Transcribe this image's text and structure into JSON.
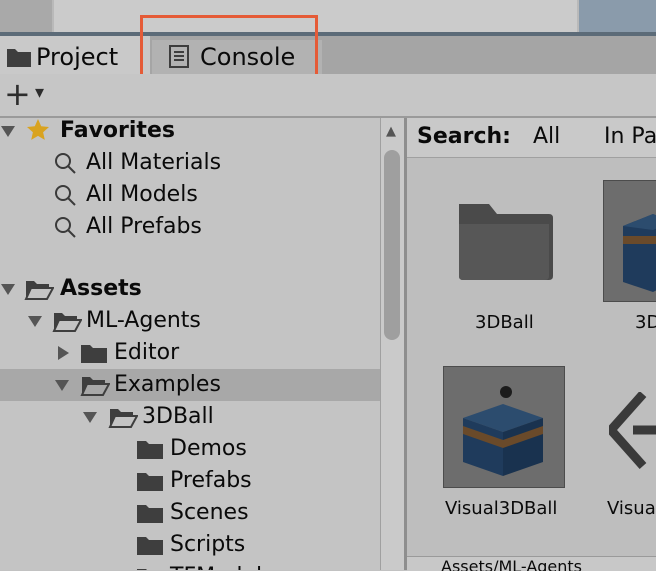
{
  "tabs": [
    {
      "label": "Project",
      "active": true
    },
    {
      "label": "Console",
      "active": false
    }
  ],
  "toolbar": {
    "add_glyph": "+",
    "dropdown_glyph": "▾"
  },
  "tree": {
    "favorites": {
      "label": "Favorites",
      "items": [
        "All Materials",
        "All Models",
        "All Prefabs"
      ]
    },
    "assets": {
      "label": "Assets"
    },
    "ml_agents": {
      "label": "ML-Agents"
    },
    "editor": {
      "label": "Editor"
    },
    "examples": {
      "label": "Examples"
    },
    "ball3d": {
      "label": "3DBall"
    },
    "children": [
      "Demos",
      "Prefabs",
      "Scenes",
      "Scripts",
      "TFModels"
    ]
  },
  "search": {
    "label": "Search:",
    "scope_all": "All",
    "scope_in": "In Pa"
  },
  "grid": {
    "items": [
      {
        "label": "3DBall",
        "icon": "folder-icon"
      },
      {
        "label": "3D",
        "icon": "prefab-cube-icon"
      },
      {
        "label": "Visual3DBall",
        "icon": "prefab-cube-icon"
      },
      {
        "label": "Visua",
        "icon": "unity-logo-icon"
      }
    ]
  },
  "bottom": {
    "path": "Assets/ML-Agents"
  },
  "colors": {
    "highlight": "#e55b37",
    "star": "#d9a320",
    "folder": "#4a4a4a",
    "cube": "#1f3b5c"
  }
}
